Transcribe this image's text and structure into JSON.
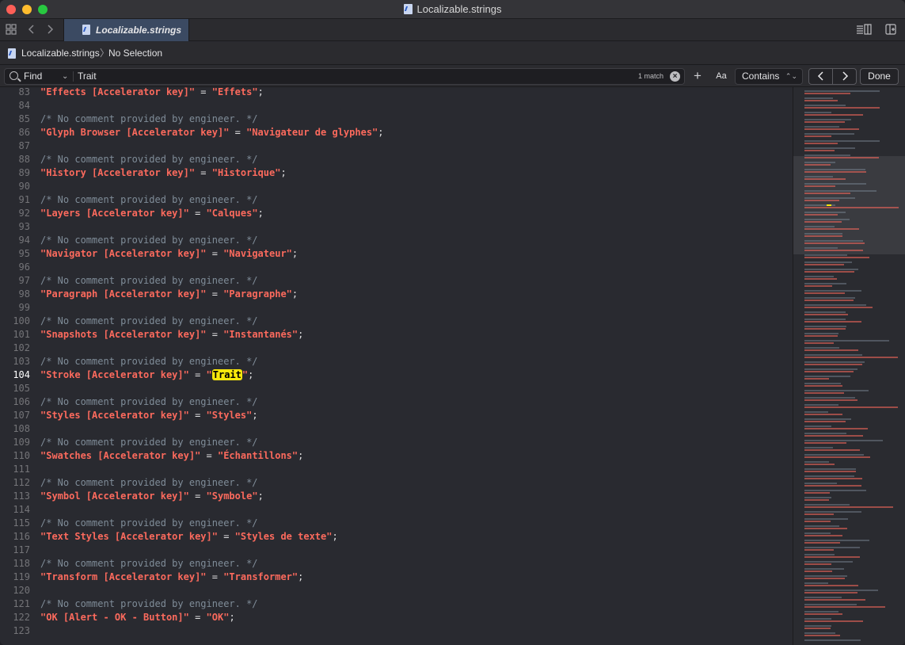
{
  "window": {
    "title": "Localizable.strings"
  },
  "tab": {
    "label": "Localizable.strings"
  },
  "jumpbar": {
    "file": "Localizable.strings",
    "separator": "〉",
    "selection": "No Selection"
  },
  "find": {
    "mode": "Find",
    "query": "Trait",
    "match_count": "1 match",
    "case_button": "Aa",
    "match_type": "Contains",
    "done_label": "Done"
  },
  "colors": {
    "string": "#fc6a5d",
    "comment": "#7f8c98",
    "highlight": "#f9e70b",
    "background": "#292a30"
  },
  "lines": [
    {
      "n": "83",
      "kind": "entry",
      "key": "\"Effects [Accelerator key]\"",
      "value": "\"Effets\""
    },
    {
      "n": "84",
      "kind": "blank"
    },
    {
      "n": "85",
      "kind": "comment",
      "text": "/* No comment provided by engineer. */"
    },
    {
      "n": "86",
      "kind": "entry",
      "key": "\"Glyph Browser [Accelerator key]\"",
      "value": "\"Navigateur de glyphes\""
    },
    {
      "n": "87",
      "kind": "blank"
    },
    {
      "n": "88",
      "kind": "comment",
      "text": "/* No comment provided by engineer. */"
    },
    {
      "n": "89",
      "kind": "entry",
      "key": "\"History [Accelerator key]\"",
      "value": "\"Historique\""
    },
    {
      "n": "90",
      "kind": "blank"
    },
    {
      "n": "91",
      "kind": "comment",
      "text": "/* No comment provided by engineer. */"
    },
    {
      "n": "92",
      "kind": "entry",
      "key": "\"Layers [Accelerator key]\"",
      "value": "\"Calques\""
    },
    {
      "n": "93",
      "kind": "blank"
    },
    {
      "n": "94",
      "kind": "comment",
      "text": "/* No comment provided by engineer. */"
    },
    {
      "n": "95",
      "kind": "entry",
      "key": "\"Navigator [Accelerator key]\"",
      "value": "\"Navigateur\""
    },
    {
      "n": "96",
      "kind": "blank"
    },
    {
      "n": "97",
      "kind": "comment",
      "text": "/* No comment provided by engineer. */"
    },
    {
      "n": "98",
      "kind": "entry",
      "key": "\"Paragraph [Accelerator key]\"",
      "value": "\"Paragraphe\""
    },
    {
      "n": "99",
      "kind": "blank"
    },
    {
      "n": "100",
      "kind": "comment",
      "text": "/* No comment provided by engineer. */"
    },
    {
      "n": "101",
      "kind": "entry",
      "key": "\"Snapshots [Accelerator key]\"",
      "value": "\"Instantanés\""
    },
    {
      "n": "102",
      "kind": "blank"
    },
    {
      "n": "103",
      "kind": "comment",
      "text": "/* No comment provided by engineer. */"
    },
    {
      "n": "104",
      "kind": "entry",
      "key": "\"Stroke [Accelerator key]\"",
      "value": "\"Trait\"",
      "highlight": "Trait",
      "current": true
    },
    {
      "n": "105",
      "kind": "blank"
    },
    {
      "n": "106",
      "kind": "comment",
      "text": "/* No comment provided by engineer. */"
    },
    {
      "n": "107",
      "kind": "entry",
      "key": "\"Styles [Accelerator key]\"",
      "value": "\"Styles\""
    },
    {
      "n": "108",
      "kind": "blank"
    },
    {
      "n": "109",
      "kind": "comment",
      "text": "/* No comment provided by engineer. */"
    },
    {
      "n": "110",
      "kind": "entry",
      "key": "\"Swatches [Accelerator key]\"",
      "value": "\"Échantillons\""
    },
    {
      "n": "111",
      "kind": "blank"
    },
    {
      "n": "112",
      "kind": "comment",
      "text": "/* No comment provided by engineer. */"
    },
    {
      "n": "113",
      "kind": "entry",
      "key": "\"Symbol [Accelerator key]\"",
      "value": "\"Symbole\""
    },
    {
      "n": "114",
      "kind": "blank"
    },
    {
      "n": "115",
      "kind": "comment",
      "text": "/* No comment provided by engineer. */"
    },
    {
      "n": "116",
      "kind": "entry",
      "key": "\"Text Styles [Accelerator key]\"",
      "value": "\"Styles de texte\""
    },
    {
      "n": "117",
      "kind": "blank"
    },
    {
      "n": "118",
      "kind": "comment",
      "text": "/* No comment provided by engineer. */"
    },
    {
      "n": "119",
      "kind": "entry",
      "key": "\"Transform [Accelerator key]\"",
      "value": "\"Transformer\""
    },
    {
      "n": "120",
      "kind": "blank"
    },
    {
      "n": "121",
      "kind": "comment",
      "text": "/* No comment provided by engineer. */"
    },
    {
      "n": "122",
      "kind": "entry",
      "key": "\"OK [Alert - OK - Button]\"",
      "value": "\"OK\""
    },
    {
      "n": "123",
      "kind": "blank"
    }
  ]
}
